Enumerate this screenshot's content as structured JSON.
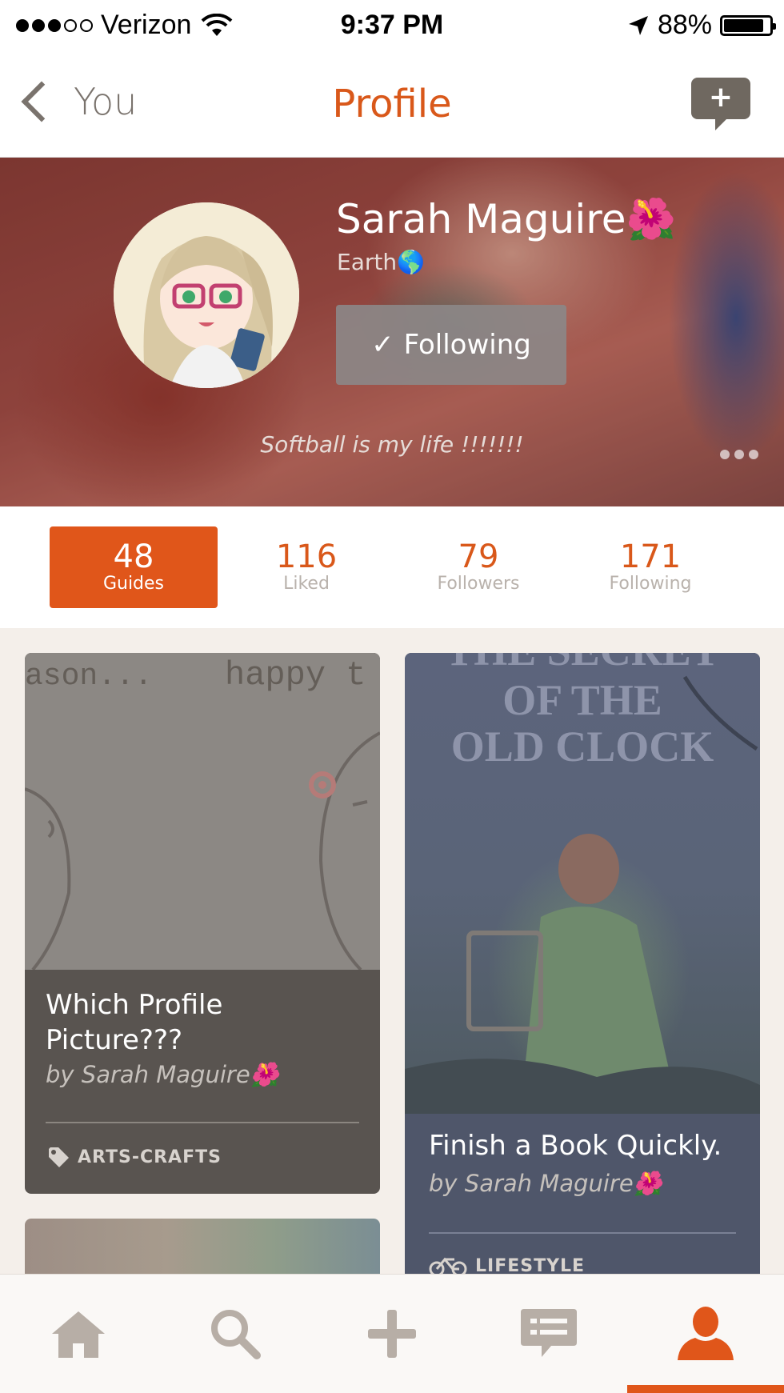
{
  "status_bar": {
    "carrier": "Verizon",
    "time": "9:37 PM",
    "battery": "88%",
    "battery_level": 0.88
  },
  "nav": {
    "back_label": "You",
    "title": "Profile",
    "compose_symbol": "+"
  },
  "profile": {
    "name": "Sarah Maguire",
    "name_emoji": "🌺",
    "location": "Earth",
    "location_emoji": "🌎",
    "follow_button": "Following",
    "follow_check": "✓",
    "bio": "Softball is my life !!!!!!!"
  },
  "stats": [
    {
      "value": "48",
      "label": "Guides",
      "active": true
    },
    {
      "value": "116",
      "label": "Liked",
      "active": false
    },
    {
      "value": "79",
      "label": "Followers",
      "active": false
    },
    {
      "value": "171",
      "label": "Following",
      "active": false
    }
  ],
  "cards": [
    {
      "image_text_left": "ason...",
      "image_text_right": "happy t",
      "title_line1": "Which Profile",
      "title_line2": "Picture???",
      "byline": "by Sarah Maguire🌺",
      "tag": "ARTS-CRAFTS",
      "tag_icon": "tag-icon"
    },
    {
      "image_text_top": "THE SECRET",
      "image_text_line2": "OF THE",
      "image_text_line3": "OLD CLOCK",
      "title": "Finish a Book Quickly.",
      "byline": "by Sarah Maguire🌺",
      "tag": "LIFESTYLE",
      "tag_icon": "bicycle-icon"
    }
  ],
  "tabbar": {
    "items": [
      "home-icon",
      "search-icon",
      "plus-icon",
      "messages-icon",
      "profile-icon"
    ],
    "active_index": 4
  },
  "colors": {
    "accent": "#e0561a",
    "title": "#d9581a",
    "muted_text": "#b9b2ac",
    "tab_icon": "#b7aea6"
  }
}
